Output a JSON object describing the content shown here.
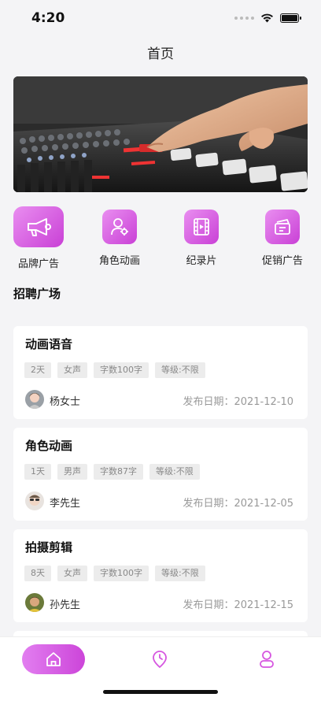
{
  "status_bar": {
    "time": "4:20"
  },
  "nav": {
    "title": "首页"
  },
  "banner": {
    "image": "mixing-console-photo"
  },
  "quick_nav": [
    {
      "label": "品牌广告",
      "icon": "megaphone-icon"
    },
    {
      "label": "角色动画",
      "icon": "person-gear-icon"
    },
    {
      "label": "纪录片",
      "icon": "film-icon"
    },
    {
      "label": "促销广告",
      "icon": "promo-card-icon"
    }
  ],
  "section": {
    "title": "招聘广场"
  },
  "jobs": [
    {
      "title": "动画语音",
      "tags": [
        "2天",
        "女声",
        "字数100字",
        "等级:不限"
      ],
      "poster": "杨女士",
      "date": "发布日期：2021-12-10"
    },
    {
      "title": "角色动画",
      "tags": [
        "1天",
        "男声",
        "字数87字",
        "等级:不限"
      ],
      "poster": "李先生",
      "date": "发布日期：2021-12-05"
    },
    {
      "title": "拍摄剪辑",
      "tags": [
        "8天",
        "女声",
        "字数100字",
        "等级:不限"
      ],
      "poster": "孙先生",
      "date": "发布日期：2021-12-15"
    }
  ],
  "tabbar": {
    "items": [
      {
        "icon": "home-icon",
        "active": true
      },
      {
        "icon": "clock-icon",
        "active": false
      },
      {
        "icon": "user-icon",
        "active": false
      }
    ]
  },
  "colors": {
    "accent": "#d656e0",
    "accent_light": "#e98ef0"
  }
}
